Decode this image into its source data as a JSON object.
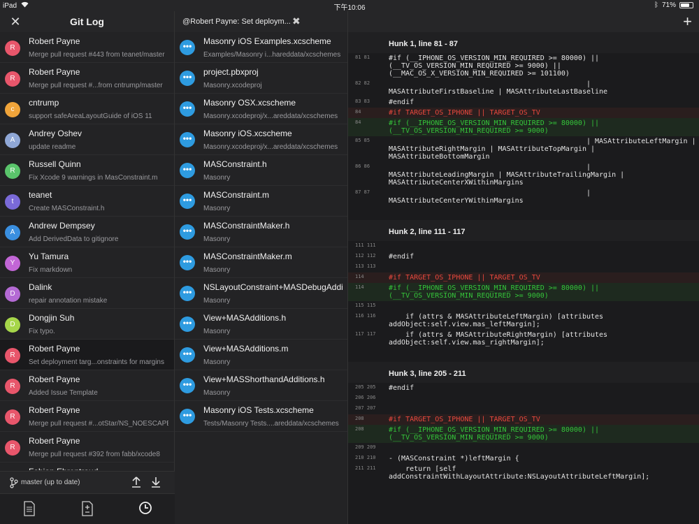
{
  "status": {
    "device": "iPad",
    "time": "下午10:06",
    "battery": "71%",
    "battery_level": 0.71
  },
  "left": {
    "title": "Git Log",
    "commits": [
      {
        "initial": "R",
        "author": "Robert Payne",
        "message": "Merge pull request #443 from teanet/master",
        "color": "#e8566b"
      },
      {
        "initial": "R",
        "author": "Robert Payne",
        "message": "Merge pull request #...from cntrump/master",
        "color": "#e8566b"
      },
      {
        "initial": "c",
        "author": "cntrump",
        "message": "support safeAreaLayoutGuide of iOS 11",
        "color": "#f0a43a"
      },
      {
        "initial": "A",
        "author": "Andrey Oshev",
        "message": "update readme",
        "color": "#8fa7d6"
      },
      {
        "initial": "R",
        "author": "Russell Quinn",
        "message": "Fix Xcode 9 warnings in MasConstraint.m",
        "color": "#5ac46b"
      },
      {
        "initial": "t",
        "author": "teanet",
        "message": "Create MASConstraint.h",
        "color": "#7a6ad8"
      },
      {
        "initial": "A",
        "author": "Andrew Dempsey",
        "message": "Add DerivedData to gitignore",
        "color": "#3a8fe0"
      },
      {
        "initial": "Y",
        "author": "Yu Tamura",
        "message": "Fix markdown",
        "color": "#c266d6"
      },
      {
        "initial": "D",
        "author": "Dalink",
        "message": "repair annotation mistake",
        "color": "#b46ad4"
      },
      {
        "initial": "D",
        "author": "Dongjin Suh",
        "message": "Fix typo.",
        "color": "#a6d64a"
      },
      {
        "initial": "R",
        "author": "Robert Payne",
        "message": "Set deployment targ...onstraints for margins",
        "color": "#e8566b"
      },
      {
        "initial": "R",
        "author": "Robert Payne",
        "message": "Added Issue Template",
        "color": "#e8566b"
      },
      {
        "initial": "R",
        "author": "Robert Payne",
        "message": "Merge pull request #...otStar/NS_NOESCAPE",
        "color": "#e8566b"
      },
      {
        "initial": "R",
        "author": "Robert Payne",
        "message": "Merge pull request #392 from fabb/xcode8",
        "color": "#e8566b"
      },
      {
        "initial": "F",
        "author": "Fabian Ehrentraud",
        "message": "",
        "color": "#3a8fe0"
      }
    ],
    "selected_index": 10,
    "branch": "master (up to date)"
  },
  "middle": {
    "title": "@Robert Payne: Set deploym...",
    "files": [
      {
        "name": "Masonry iOS Examples.xcscheme",
        "path": "Examples/Masonry i...hareddata/xcschemes"
      },
      {
        "name": "project.pbxproj",
        "path": "Masonry.xcodeproj"
      },
      {
        "name": "Masonry OSX.xcscheme",
        "path": "Masonry.xcodeproj/x...areddata/xcschemes"
      },
      {
        "name": "Masonry iOS.xcscheme",
        "path": "Masonry.xcodeproj/x...areddata/xcschemes"
      },
      {
        "name": "MASConstraint.h",
        "path": "Masonry"
      },
      {
        "name": "MASConstraint.m",
        "path": "Masonry"
      },
      {
        "name": "MASConstraintMaker.h",
        "path": "Masonry"
      },
      {
        "name": "MASConstraintMaker.m",
        "path": "Masonry"
      },
      {
        "name": "NSLayoutConstraint+MASDebugAddi...",
        "path": "Masonry"
      },
      {
        "name": "View+MASAdditions.h",
        "path": "Masonry"
      },
      {
        "name": "View+MASAdditions.m",
        "path": "Masonry"
      },
      {
        "name": "View+MASShorthandAdditions.h",
        "path": "Masonry"
      },
      {
        "name": "Masonry iOS Tests.xcscheme",
        "path": "Tests/Masonry Tests....areddata/xcschemes"
      }
    ]
  },
  "diff": {
    "hunks": [
      {
        "header": "Hunk 1, line 81 - 87",
        "lines": [
          {
            "type": "ctx",
            "ln": "81  81",
            "text": "#if (__IPHONE_OS_VERSION_MIN_REQUIRED >= 80000) || (__TV_OS_VERSION_MIN_REQUIRED >= 9000) || (__MAC_OS_X_VERSION_MIN_REQUIRED >= 101100)"
          },
          {
            "type": "ctx",
            "ln": "82  82",
            "text": "                                               |\nMASAttributeFirstBaseline | MASAttributeLastBaseline"
          },
          {
            "type": "ctx",
            "ln": "83  83",
            "text": "#endif"
          },
          {
            "type": "del",
            "ln": "84",
            "text": "#if TARGET_OS_IPHONE || TARGET_OS_TV"
          },
          {
            "type": "add",
            "ln": "    84",
            "text": "#if (__IPHONE_OS_VERSION_MIN_REQUIRED >= 80000) || (__TV_OS_VERSION_MIN_REQUIRED >= 9000)"
          },
          {
            "type": "ctx",
            "ln": "85  85",
            "text": "                                               | MASAttributeLeftMargin | MASAttributeRightMargin | MASAttributeTopMargin | MASAttributeBottomMargin"
          },
          {
            "type": "ctx",
            "ln": "86  86",
            "text": "                                               |\nMASAttributeLeadingMargin | MASAttributeTrailingMargin | MASAttributeCenterXWithinMargins"
          },
          {
            "type": "ctx",
            "ln": "87  87",
            "text": "                                               |\nMASAttributeCenterYWithinMargins"
          }
        ]
      },
      {
        "header": "Hunk 2, line 111 - 117",
        "lines": [
          {
            "type": "ctx",
            "ln": "111 111",
            "text": " "
          },
          {
            "type": "ctx",
            "ln": "112 112",
            "text": "#endif"
          },
          {
            "type": "ctx",
            "ln": "113 113",
            "text": " "
          },
          {
            "type": "del",
            "ln": "114",
            "text": "#if TARGET_OS_IPHONE || TARGET_OS_TV"
          },
          {
            "type": "add",
            "ln": "    114",
            "text": "#if (__IPHONE_OS_VERSION_MIN_REQUIRED >= 80000) || (__TV_OS_VERSION_MIN_REQUIRED >= 9000)"
          },
          {
            "type": "ctx",
            "ln": "115 115",
            "text": " "
          },
          {
            "type": "ctx",
            "ln": "116 116",
            "text": "    if (attrs & MASAttributeLeftMargin) [attributes addObject:self.view.mas_leftMargin];"
          },
          {
            "type": "ctx",
            "ln": "117 117",
            "text": "    if (attrs & MASAttributeRightMargin) [attributes addObject:self.view.mas_rightMargin];"
          }
        ]
      },
      {
        "header": "Hunk 3, line 205 - 211",
        "lines": [
          {
            "type": "ctx",
            "ln": "205 205",
            "text": "#endif"
          },
          {
            "type": "ctx",
            "ln": "206 206",
            "text": " "
          },
          {
            "type": "ctx",
            "ln": "207 207",
            "text": " "
          },
          {
            "type": "del",
            "ln": "208",
            "text": "#if TARGET_OS_IPHONE || TARGET_OS_TV"
          },
          {
            "type": "add",
            "ln": "    208",
            "text": "#if (__IPHONE_OS_VERSION_MIN_REQUIRED >= 80000) || (__TV_OS_VERSION_MIN_REQUIRED >= 9000)"
          },
          {
            "type": "ctx",
            "ln": "209 209",
            "text": " "
          },
          {
            "type": "ctx",
            "ln": "210 210",
            "text": "- (MASConstraint *)leftMargin {"
          },
          {
            "type": "ctx",
            "ln": "211 211",
            "text": "    return [self addConstraintWithLayoutAttribute:NSLayoutAttributeLeftMargin];"
          }
        ]
      }
    ]
  },
  "icons": {
    "close": "close-icon",
    "branch": "branch-icon",
    "push": "arrow-up-icon",
    "pull": "arrow-down-icon",
    "tab_files": "document-icon",
    "tab_changes": "diff-document-icon",
    "tab_history": "clock-icon",
    "add": "plus-icon"
  }
}
